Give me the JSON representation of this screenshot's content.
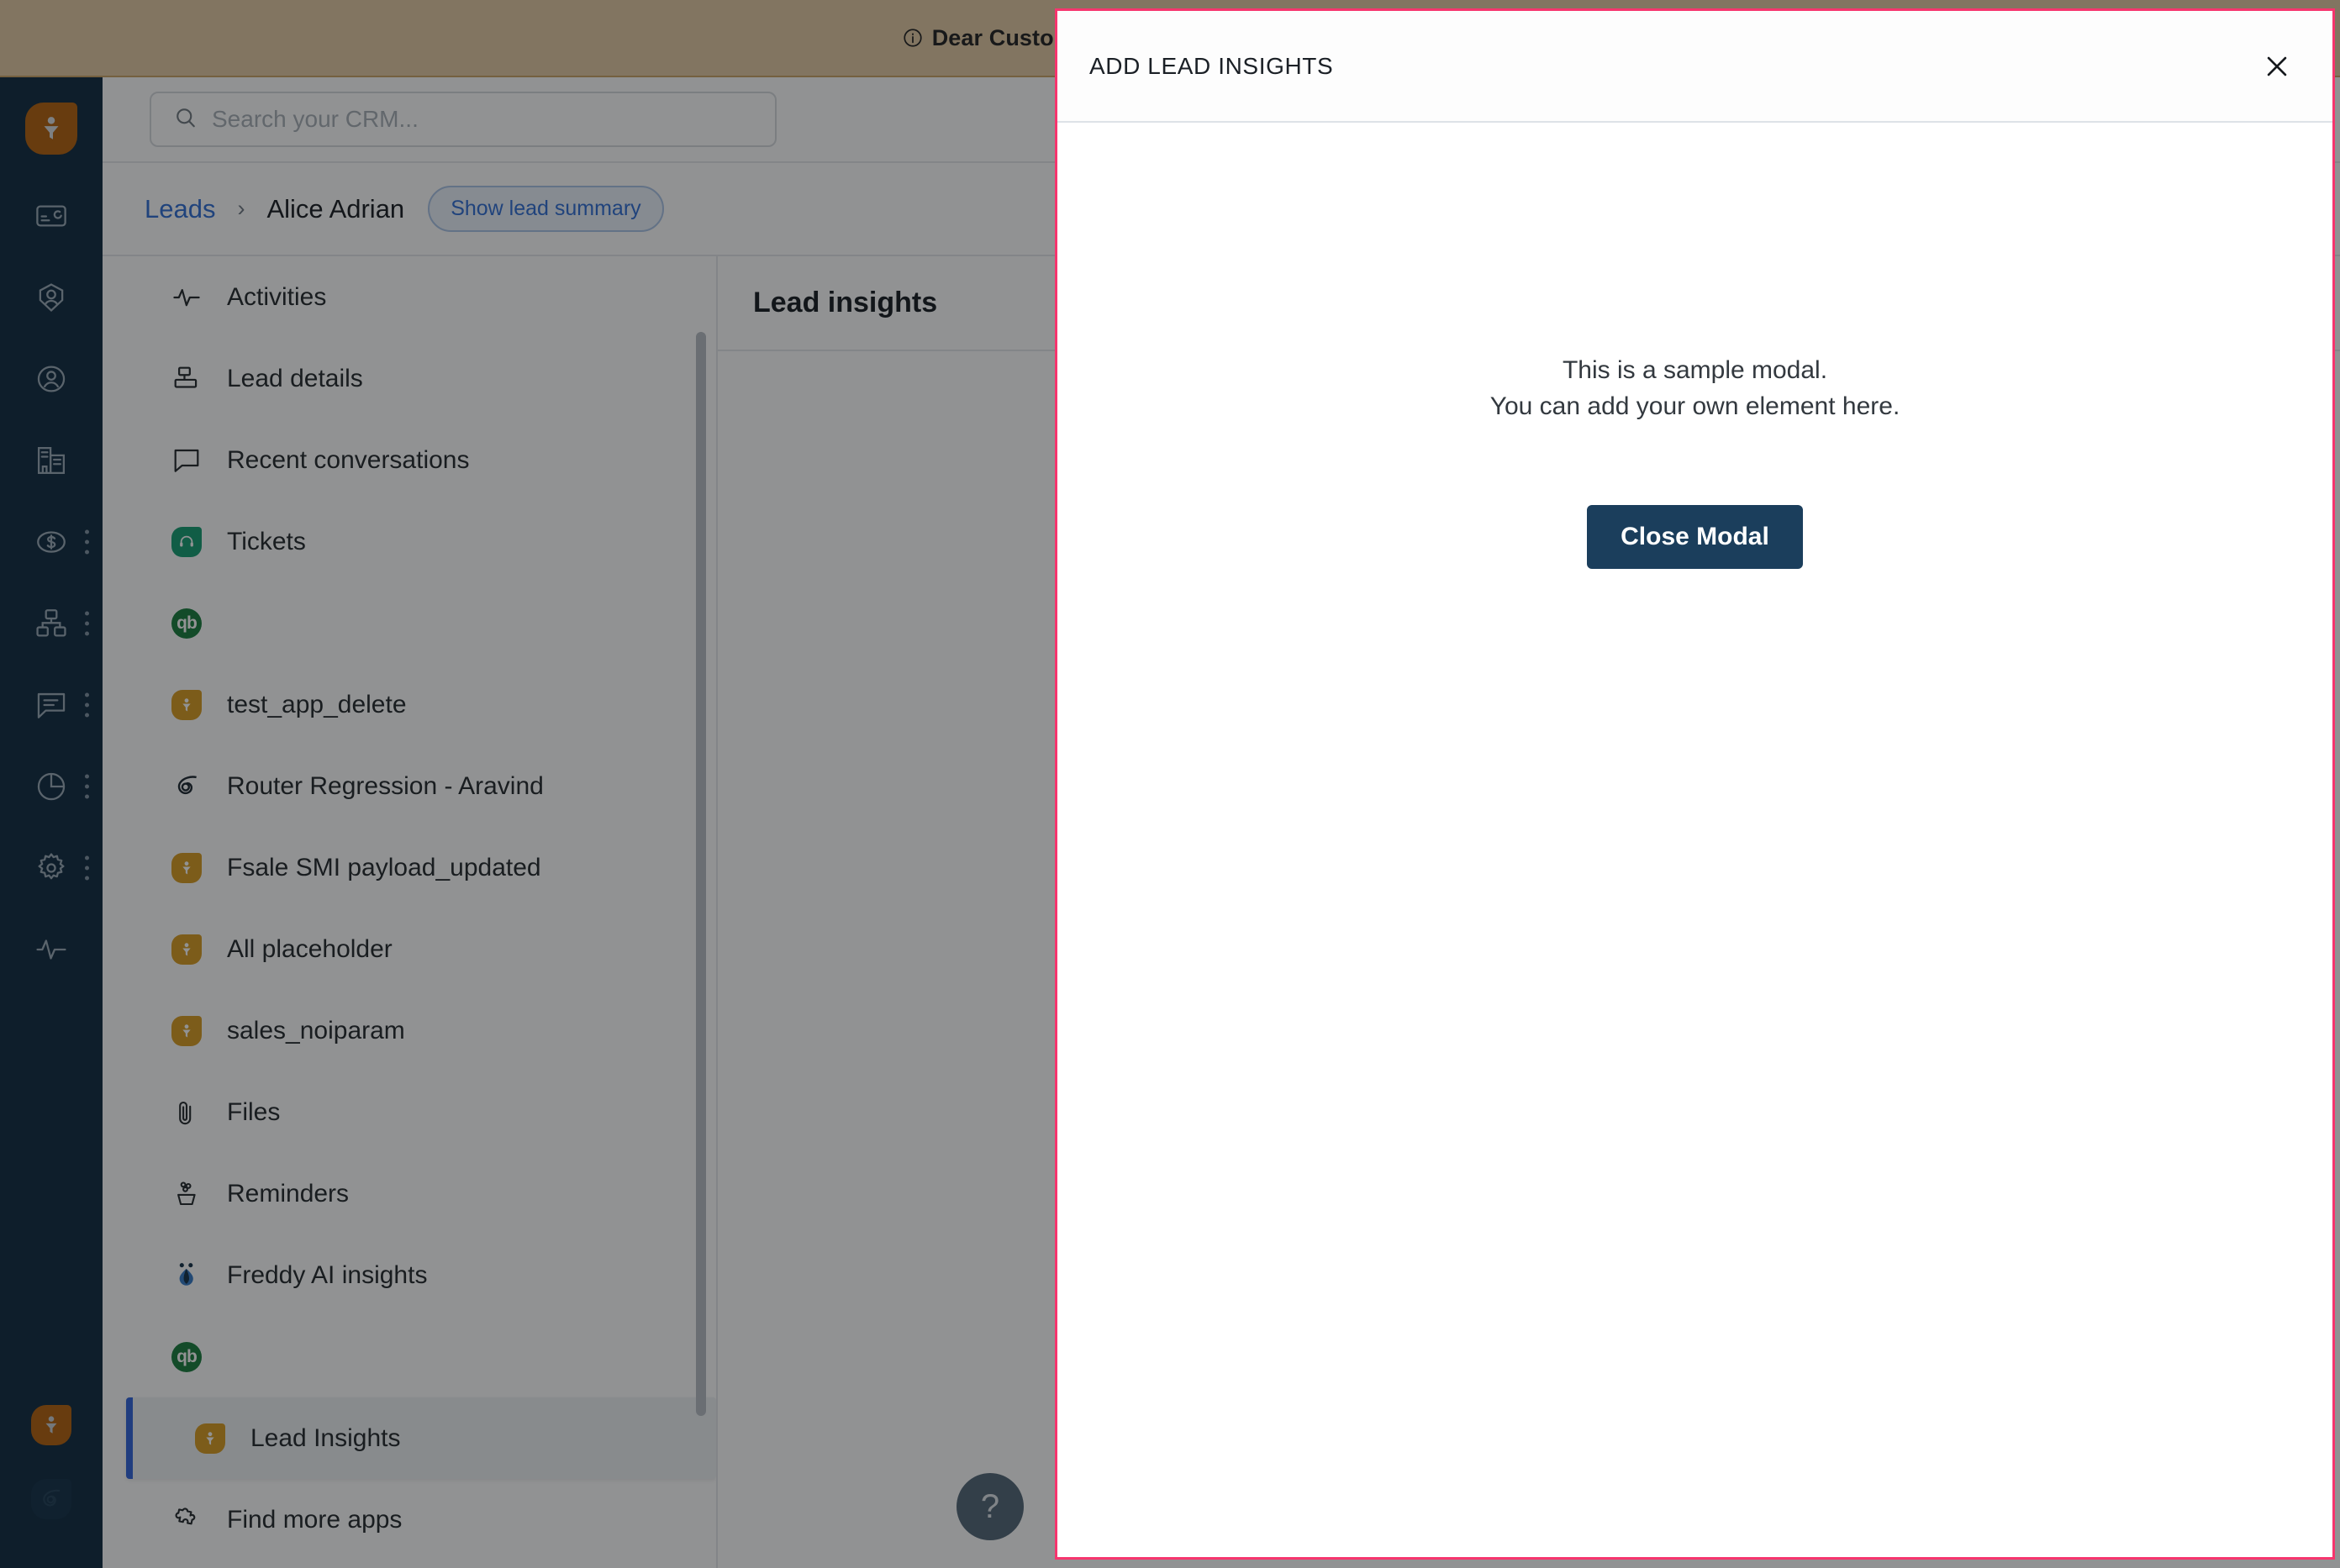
{
  "banner": {
    "text": "Dear Customer, We have updated our policy ar",
    "icon": "info-circle-icon"
  },
  "search": {
    "placeholder": "Search your CRM...",
    "value": "",
    "icon": "search-icon"
  },
  "breadcrumb": {
    "root": "Leads",
    "separator": "›",
    "current": "Alice Adrian",
    "summary_button": "Show lead summary"
  },
  "left_rail": {
    "logo": "freshsales-funnel-logo",
    "items": [
      {
        "name": "dashboard-card-icon",
        "has_dots": false
      },
      {
        "name": "contacts-icon",
        "has_dots": false
      },
      {
        "name": "accounts-icon",
        "has_dots": false
      },
      {
        "name": "companies-icon",
        "has_dots": false
      },
      {
        "name": "deals-dollar-icon",
        "has_dots": true
      },
      {
        "name": "apps-grid-icon",
        "has_dots": true
      },
      {
        "name": "chat-icon",
        "has_dots": true
      },
      {
        "name": "reports-pie-icon",
        "has_dots": true
      },
      {
        "name": "settings-gear-icon",
        "has_dots": true
      },
      {
        "name": "activity-pulse-icon",
        "has_dots": false
      }
    ],
    "bottom_badges": [
      {
        "name": "freshsales-app-badge",
        "color": "#b25e07"
      },
      {
        "name": "router-app-badge",
        "color": "#0d2b42"
      }
    ]
  },
  "nav": {
    "items": [
      {
        "label": "Activities",
        "icon": "pulse-icon",
        "icon_kind": "line",
        "selected": false
      },
      {
        "label": "Lead details",
        "icon": "lead-details-icon",
        "icon_kind": "line",
        "selected": false
      },
      {
        "label": "Recent conversations",
        "icon": "chat-bubble-icon",
        "icon_kind": "line",
        "selected": false
      },
      {
        "label": "Tickets",
        "icon": "headset-icon",
        "icon_kind": "teal",
        "selected": false
      },
      {
        "label": "",
        "icon": "quickbooks-icon",
        "icon_kind": "qb",
        "selected": false
      },
      {
        "label": "test_app_delete",
        "icon": "funnel-app-icon",
        "icon_kind": "orange",
        "selected": false
      },
      {
        "label": "Router Regression - Aravind",
        "icon": "router-swirl-icon",
        "icon_kind": "swirl",
        "selected": false
      },
      {
        "label": "Fsale SMI payload_updated",
        "icon": "funnel-app-icon",
        "icon_kind": "orange",
        "selected": false
      },
      {
        "label": "All placeholder",
        "icon": "funnel-app-icon",
        "icon_kind": "orange",
        "selected": false
      },
      {
        "label": "sales_noiparam",
        "icon": "funnel-app-icon",
        "icon_kind": "orange",
        "selected": false
      },
      {
        "label": "Files",
        "icon": "paperclip-icon",
        "icon_kind": "line",
        "selected": false
      },
      {
        "label": "Reminders",
        "icon": "reminder-icon",
        "icon_kind": "line",
        "selected": false
      },
      {
        "label": "Freddy AI insights",
        "icon": "freddy-ai-icon",
        "icon_kind": "freddy",
        "selected": false
      },
      {
        "label": "",
        "icon": "quickbooks-icon",
        "icon_kind": "qb",
        "selected": false
      },
      {
        "label": "Lead Insights",
        "icon": "funnel-app-icon",
        "icon_kind": "orange",
        "selected": true
      },
      {
        "label": "Find more apps",
        "icon": "puzzle-piece-icon",
        "icon_kind": "line",
        "selected": false
      }
    ]
  },
  "main": {
    "panel_title": "Lead insights"
  },
  "help": {
    "label": "?",
    "icon": "help-question-icon"
  },
  "modal": {
    "title": "ADD LEAD INSIGHTS",
    "close_icon": "close-icon",
    "body_line_1": "This is a sample modal.",
    "body_line_2": "You can add your own element here.",
    "primary_button": "Close Modal",
    "border_color": "#f6356e",
    "button_color": "#1b3e5c"
  }
}
